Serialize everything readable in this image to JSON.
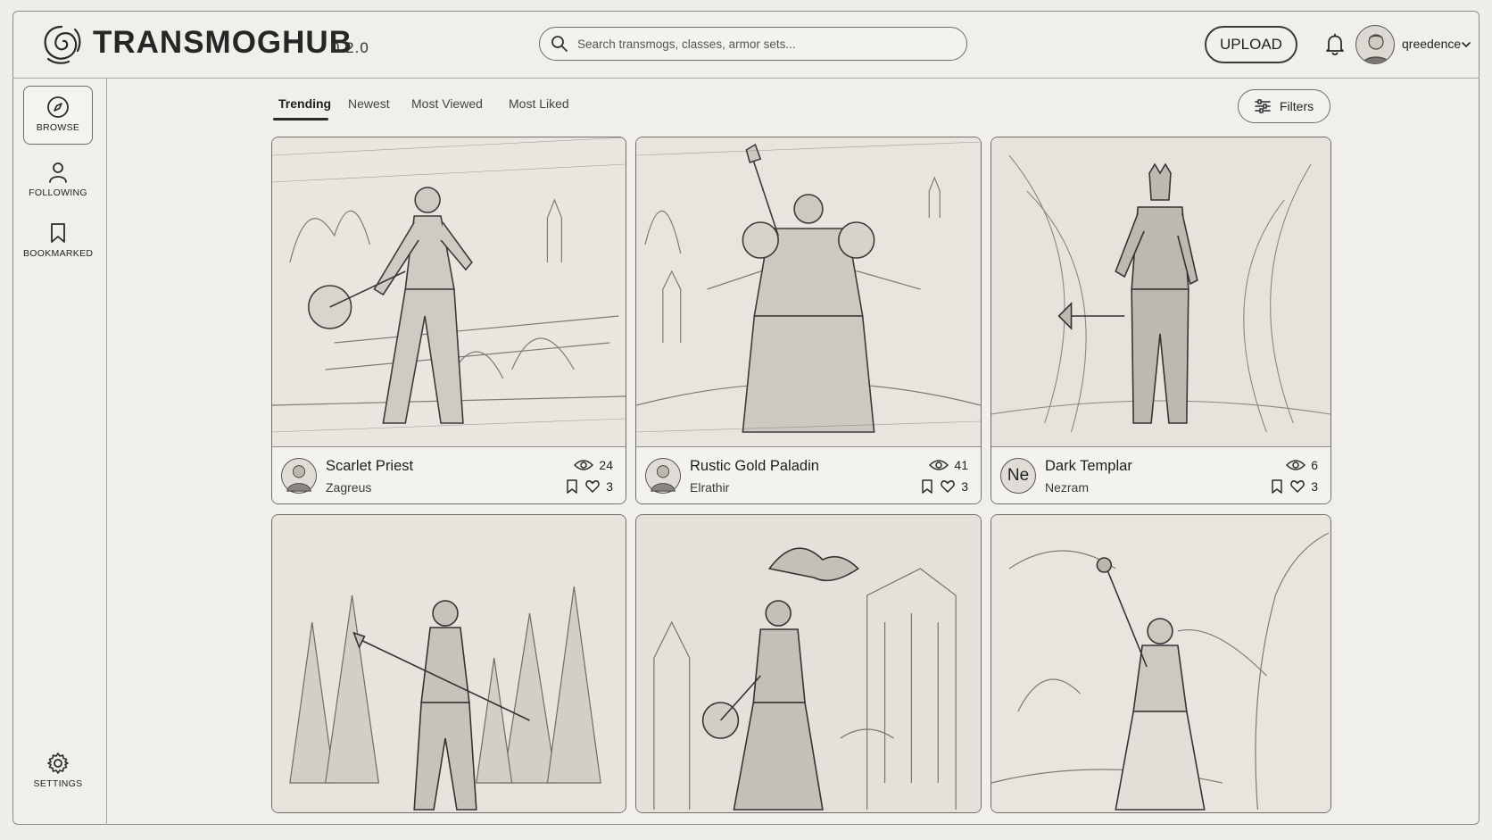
{
  "app": {
    "name": "TRANSMOGHUB",
    "version": "0.2.0"
  },
  "search": {
    "placeholder": "Search transmogs, classes, armor sets..."
  },
  "header": {
    "upload_label": "UPLOAD",
    "username": "qreedence"
  },
  "sidebar": {
    "items": [
      {
        "label": "BROWSE",
        "icon": "compass-icon",
        "active": true
      },
      {
        "label": "FOLLOWING",
        "icon": "person-icon",
        "active": false
      },
      {
        "label": "BOOKMARKED",
        "icon": "bookmark-icon",
        "active": false
      }
    ],
    "settings_label": "SETTINGS"
  },
  "tabs": [
    {
      "label": "Trending",
      "active": true
    },
    {
      "label": "Newest",
      "active": false
    },
    {
      "label": "Most Viewed",
      "active": false
    },
    {
      "label": "Most Liked",
      "active": false
    }
  ],
  "filters_label": "Filters",
  "cards": [
    {
      "title": "Scarlet Priest",
      "author": "Zagreus",
      "views": "24",
      "likes": "3",
      "avatar": ""
    },
    {
      "title": "Rustic Gold Paladin",
      "author": "Elrathir",
      "views": "41",
      "likes": "3",
      "avatar": ""
    },
    {
      "title": "Dark Templar",
      "author": "Nezram",
      "views": "6",
      "likes": "3",
      "avatar": "Ne"
    }
  ]
}
